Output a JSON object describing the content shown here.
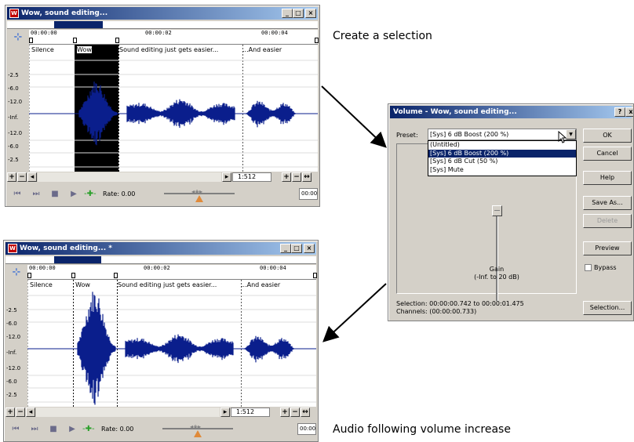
{
  "windows": [
    {
      "title": "Wow, sound editing...",
      "ruler": [
        "00:00:00",
        "00:00:02",
        "00:00:04"
      ],
      "db_scale": [
        "-2.5",
        "-6.0",
        "-12.0",
        "-Inf.",
        "-12.0",
        "-6.0",
        "-2.5"
      ],
      "regions": [
        "Silence",
        "Wow",
        "Sound editing just gets easier...",
        "...And easier"
      ],
      "zoom": "1:512",
      "rate": "Rate: 0.00",
      "time": "00:00"
    },
    {
      "title": "Wow, sound editing... *",
      "ruler": [
        "00:00:00",
        "00:00:02",
        "00:00:04"
      ],
      "db_scale": [
        "-2.5",
        "-6.0",
        "-12.0",
        "-Inf.",
        "-12.0",
        "-6.0",
        "-2.5"
      ],
      "regions": [
        "Silence",
        "Wow",
        "Sound editing just gets easier...",
        "...And easier"
      ],
      "zoom": "1:512",
      "rate": "Rate: 0.00",
      "time": "00:00"
    }
  ],
  "captions": {
    "top": "Create a selection",
    "bottom": "Audio following volume increase"
  },
  "dialog": {
    "title": "Volume - Wow, sound editing...",
    "title_buttons": [
      "?",
      "x"
    ],
    "preset_label": "Preset:",
    "preset_value": "[Sys] 6 dB Boost (200 %)",
    "preset_options": [
      "(Untitled)",
      "[Sys] 6 dB Boost (200 %)",
      "[Sys] 6 dB Cut (50 %)",
      "[Sys] Mute"
    ],
    "preset_selected_index": 1,
    "gain_label": "Gain",
    "gain_range": "(-Inf. to 20 dB)",
    "selection_info": "Selection:  00:00:00.742 to 00:00:01.475",
    "channels_info": "Channels:  (00:00:00.733)",
    "buttons": {
      "ok": "OK",
      "cancel": "Cancel",
      "help": "Help",
      "save_as": "Save As...",
      "delete": "Delete",
      "preview": "Preview",
      "selection": "Selection..."
    },
    "bypass_label": "Bypass"
  },
  "colors": {
    "waveform": "#0a1e8c",
    "selection": "#000000",
    "titlebar": "#0a246a"
  }
}
